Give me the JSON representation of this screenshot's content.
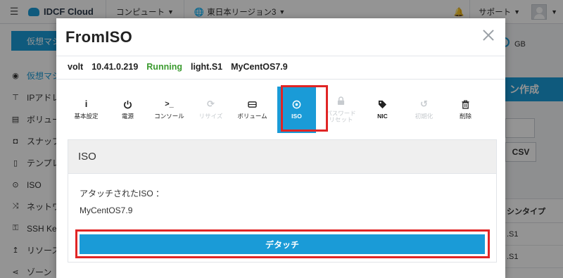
{
  "topbar": {
    "brand": "IDCF Cloud",
    "nav": [
      {
        "label": "コンピュート",
        "icon": "chevron-down-icon"
      },
      {
        "label": "東日本リージョン3",
        "icon": "globe-icon"
      }
    ],
    "support_label": "サポート"
  },
  "sidebar": {
    "create_label": "仮想マシ",
    "items": [
      {
        "label": "仮想マシ",
        "icon": "dashboard-icon"
      },
      {
        "label": "IPアドレ",
        "icon": "network-icon"
      },
      {
        "label": "ボリュー",
        "icon": "volume-icon"
      },
      {
        "label": "スナップ",
        "icon": "camera-icon"
      },
      {
        "label": "テンプレ",
        "icon": "document-icon"
      },
      {
        "label": "ISO",
        "icon": "iso-icon"
      },
      {
        "label": "ネットワ",
        "icon": "shuffle-icon"
      },
      {
        "label": "SSH Key",
        "icon": "key-icon"
      },
      {
        "label": "リソース",
        "icon": "upload-icon"
      },
      {
        "label": "ゾーン",
        "icon": "share-icon"
      }
    ]
  },
  "background": {
    "storage_unit": "GB",
    "create_button": "ン作成",
    "csv_button": "CSV",
    "table_header": "シンタイプ",
    "table_rows": [
      ".S1",
      ".S1"
    ]
  },
  "modal": {
    "title": "FromISO",
    "info": {
      "name": "volt",
      "ip": "10.41.0.219",
      "status": "Running",
      "plan": "light.S1",
      "os": "MyCentOS7.9"
    },
    "actions": [
      {
        "id": "basic",
        "label": "基本設定",
        "icon": "info-icon",
        "glyph": "i",
        "state": "normal"
      },
      {
        "id": "power",
        "label": "電源",
        "icon": "power-icon",
        "glyph": "⏻",
        "state": "normal"
      },
      {
        "id": "console",
        "label": "コンソール",
        "icon": "console-icon",
        "glyph": ">_",
        "state": "normal"
      },
      {
        "id": "resize",
        "label": "リサイズ",
        "icon": "refresh-icon",
        "glyph": "⟳",
        "state": "disabled"
      },
      {
        "id": "volume",
        "label": "ボリューム",
        "icon": "drive-icon",
        "glyph": "⊟",
        "state": "normal"
      },
      {
        "id": "iso",
        "label": "ISO",
        "icon": "iso-icon",
        "glyph": "◉",
        "state": "active"
      },
      {
        "id": "password",
        "label": "パスワード\nリセット",
        "icon": "lock-icon",
        "glyph": "🔒",
        "state": "disabled"
      },
      {
        "id": "nic",
        "label": "NIC",
        "icon": "tag-icon",
        "glyph": "⬥",
        "state": "normal"
      },
      {
        "id": "reinit",
        "label": "初期化",
        "icon": "undo-icon",
        "glyph": "↺",
        "state": "disabled"
      },
      {
        "id": "delete",
        "label": "削除",
        "icon": "trash-icon",
        "glyph": "🗑",
        "state": "normal"
      }
    ],
    "iso_panel": {
      "heading": "ISO",
      "attached_label": "アタッチされたISO ：",
      "attached_value": "MyCentOS7.9",
      "detach_label": "デタッチ"
    }
  }
}
